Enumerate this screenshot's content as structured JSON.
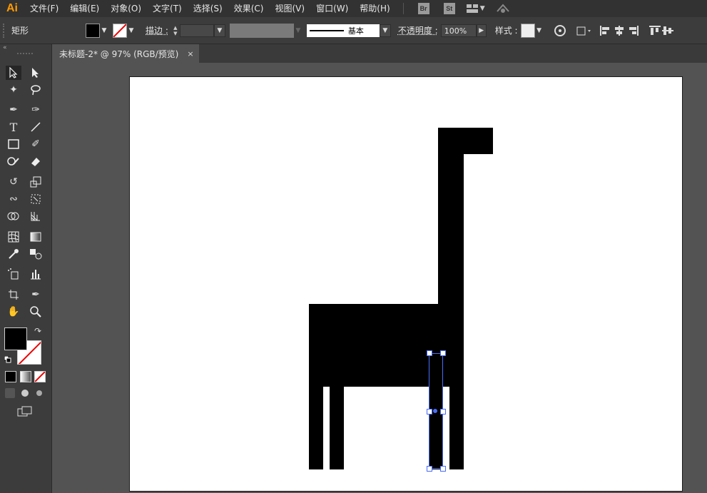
{
  "app": {
    "logo": "Ai"
  },
  "menus": [
    "文件(F)",
    "编辑(E)",
    "对象(O)",
    "文字(T)",
    "选择(S)",
    "效果(C)",
    "视图(V)",
    "窗口(W)",
    "帮助(H)"
  ],
  "apps": {
    "bridge": "Br",
    "stock": "St"
  },
  "control": {
    "object_type": "矩形",
    "stroke_label": "描边 :",
    "stroke_profile": "基本",
    "opacity_label": "不透明度 :",
    "opacity_value": "100%",
    "style_label": "样式 :"
  },
  "tab": {
    "title": "未标题-2* @ 97% (RGB/预览)",
    "close": "×"
  },
  "colors": {
    "fill": "#000000",
    "stroke": "none",
    "accent": "#ff9a00",
    "selection": "#4a6cf7"
  },
  "icons": [
    "selection-tool-icon",
    "direct-selection-tool-icon",
    "magic-wand-icon",
    "lasso-icon",
    "pen-tool-icon",
    "curvature-tool-icon",
    "type-tool-icon",
    "line-tool-icon",
    "rectangle-tool-icon",
    "paintbrush-icon",
    "shaper-tool-icon",
    "eraser-icon",
    "rotate-tool-icon",
    "scale-tool-icon",
    "warp-tool-icon",
    "free-transform-icon",
    "shape-builder-icon",
    "perspective-grid-icon",
    "mesh-tool-icon",
    "gradient-tool-icon",
    "eyedropper-icon",
    "blend-tool-icon",
    "symbol-sprayer-icon",
    "graph-tool-icon",
    "artboard-tool-icon",
    "slice-tool-icon",
    "hand-tool-icon",
    "zoom-tool-icon"
  ]
}
